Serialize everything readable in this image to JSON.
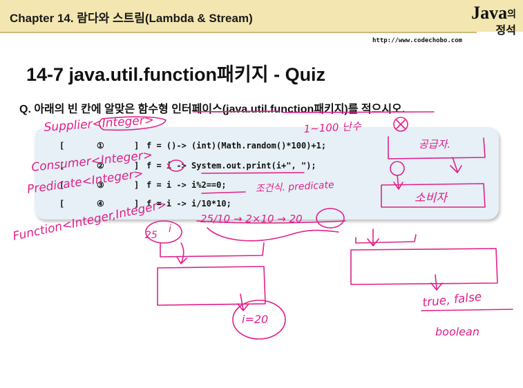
{
  "header": {
    "chapter": "Chapter 14. 람다와 스트림(Lambda & Stream)",
    "logo_java": "Java",
    "logo_ui": "의",
    "logo_jeongseok": "정석",
    "url": "http://www.codechobo.com"
  },
  "slide": {
    "title": "14-7 java.util.function패키지 - Quiz",
    "question": "Q. 아래의 빈 칸에 알맞은 함수형 인터페이스(java.util.function패키지)를 적으시오."
  },
  "code": {
    "rows": [
      {
        "open": "[",
        "num": "①",
        "close": "]",
        "code": "f = ()-> (int)(Math.random()*100)+1;"
      },
      {
        "open": "[",
        "num": "②",
        "close": "]",
        "code": "f = i -> System.out.print(i+\", \");"
      },
      {
        "open": "[",
        "num": "③",
        "close": "]",
        "code": "f = i -> i%2==0;"
      },
      {
        "open": "[",
        "num": "④",
        "close": "]",
        "code": "f = i -> i/10*10;"
      }
    ]
  },
  "handwriting": {
    "supplier": "Supplier<Integer>",
    "consumer": "Consumer<Integer>",
    "predicate": "Predicate<Integer>",
    "function": "Function<Integer,Integer>",
    "range": "1~100 난수",
    "supply": "공급자.",
    "consumer_kr": "소비자",
    "condition": "조건식. predicate",
    "example": "25/10 → 2×10 → 20",
    "input_25": "25",
    "input_i": "i",
    "result_20": "i=20",
    "true_false": "true, false",
    "boolean": "boolean"
  },
  "colors": {
    "ink": "#e0208a",
    "header": "#f3e6b0",
    "codebox": "#e6f0f6"
  }
}
